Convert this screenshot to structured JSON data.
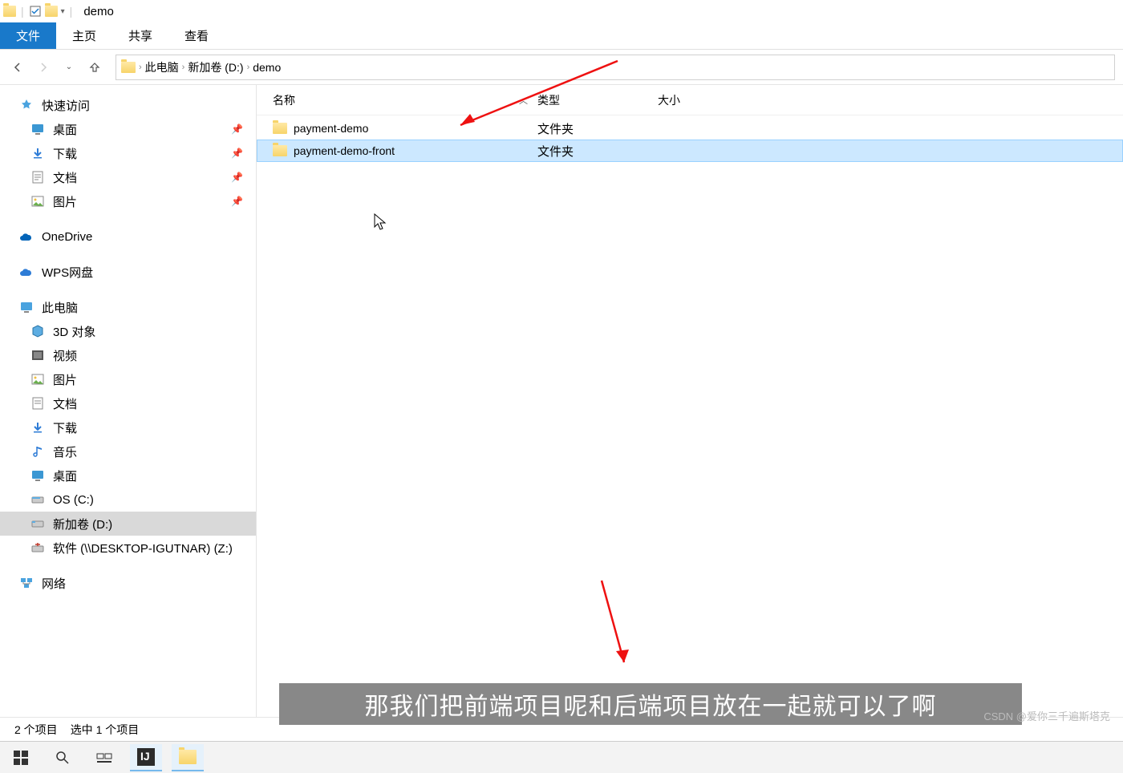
{
  "window": {
    "title": "demo"
  },
  "ribbon": {
    "tabs": [
      "文件",
      "主页",
      "共享",
      "查看"
    ],
    "active_index": 0
  },
  "breadcrumb": {
    "items": [
      "此电脑",
      "新加卷 (D:)",
      "demo"
    ]
  },
  "sidebar": {
    "quick_access": {
      "label": "快速访问"
    },
    "pinned": [
      {
        "label": "桌面",
        "icon": "desktop"
      },
      {
        "label": "下载",
        "icon": "download"
      },
      {
        "label": "文档",
        "icon": "document"
      },
      {
        "label": "图片",
        "icon": "picture"
      }
    ],
    "cloud": [
      {
        "label": "OneDrive",
        "icon": "onedrive"
      },
      {
        "label": "WPS网盘",
        "icon": "wps"
      }
    ],
    "this_pc": {
      "label": "此电脑"
    },
    "folders": [
      {
        "label": "3D 对象",
        "icon": "3d"
      },
      {
        "label": "视频",
        "icon": "video"
      },
      {
        "label": "图片",
        "icon": "picture"
      },
      {
        "label": "文档",
        "icon": "document"
      },
      {
        "label": "下载",
        "icon": "download"
      },
      {
        "label": "音乐",
        "icon": "music"
      },
      {
        "label": "桌面",
        "icon": "desktop"
      },
      {
        "label": "OS (C:)",
        "icon": "drive"
      },
      {
        "label": "新加卷 (D:)",
        "icon": "drive",
        "selected": true
      },
      {
        "label": "软件 (\\\\DESKTOP-IGUTNAR) (Z:)",
        "icon": "netdrive"
      }
    ],
    "network": {
      "label": "网络"
    }
  },
  "columns": {
    "name": "名称",
    "type": "类型",
    "size": "大小"
  },
  "files": [
    {
      "name": "payment-demo",
      "type": "文件夹",
      "selected": false
    },
    {
      "name": "payment-demo-front",
      "type": "文件夹",
      "selected": true
    }
  ],
  "status": {
    "items_count": "2 个项目",
    "selected_count": "选中 1 个项目"
  },
  "caption": "那我们把前端项目呢和后端项目放在一起就可以了啊",
  "watermark": "CSDN @爱你三千遍斯塔克"
}
